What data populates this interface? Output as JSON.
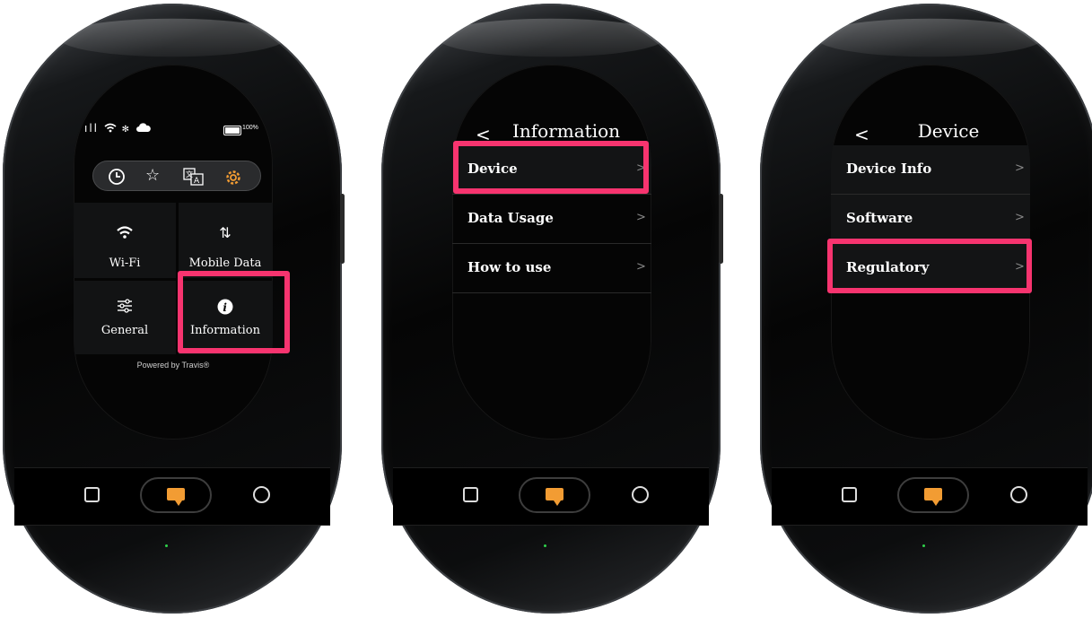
{
  "colors": {
    "highlight": "#f7346f",
    "accent": "#f29c33",
    "led": "#2fd14a"
  },
  "icons": {
    "nav_left": "square-icon",
    "nav_center": "chat-icon",
    "nav_right": "circle-icon",
    "chevron": "chevron-right-icon",
    "back": "chevron-left-icon"
  },
  "screen1": {
    "status": {
      "signal": "ıll",
      "battery_text": "100%"
    },
    "icon_bar": [
      "history-icon",
      "star-icon",
      "translate-icon",
      "settings-icon"
    ],
    "tiles": [
      {
        "label": "Wi-Fi",
        "icon": "wifi-icon"
      },
      {
        "label": "Mobile Data",
        "icon": "mobile-data-icon"
      },
      {
        "label": "General",
        "icon": "sliders-icon"
      },
      {
        "label": "Information",
        "icon": "info-icon"
      }
    ],
    "powered_by": "Powered by Travis®"
  },
  "screen2": {
    "title": "Information",
    "items": [
      "Device",
      "Data Usage",
      "How to use"
    ]
  },
  "screen3": {
    "title": "Device",
    "items": [
      "Device Info",
      "Software",
      "Regulatory"
    ]
  }
}
